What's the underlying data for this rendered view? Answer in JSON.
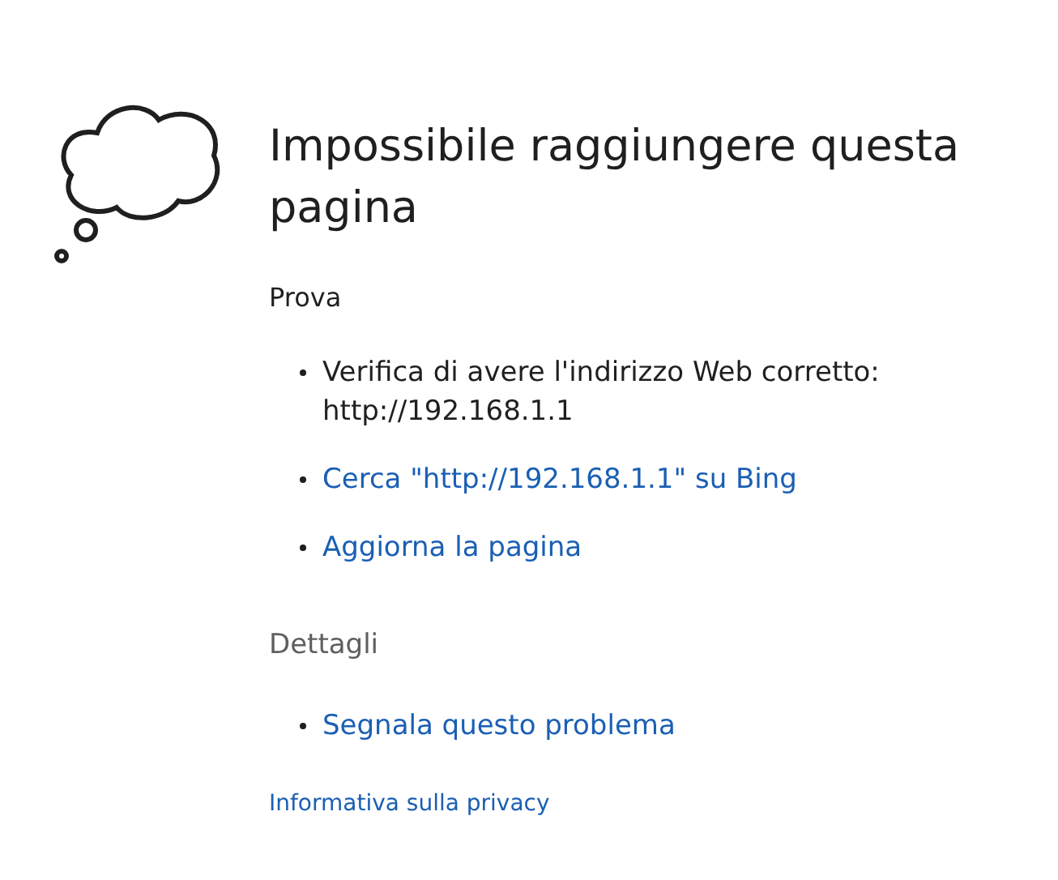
{
  "title": "Impossibile raggiungere questa pagina",
  "try_section": {
    "heading": "Prova",
    "items": [
      {
        "kind": "text",
        "text": "Verifica di avere l'indirizzo Web corretto:",
        "detail": "http://192.168.1.1"
      },
      {
        "kind": "link",
        "text": "Cerca \"http://192.168.1.1\" su Bing"
      },
      {
        "kind": "link",
        "text": "Aggiorna la pagina"
      }
    ]
  },
  "details_section": {
    "heading": "Dettagli",
    "items": [
      {
        "kind": "link",
        "text": "Segnala questo problema"
      }
    ]
  },
  "footer_link": "Informativa sulla privacy"
}
